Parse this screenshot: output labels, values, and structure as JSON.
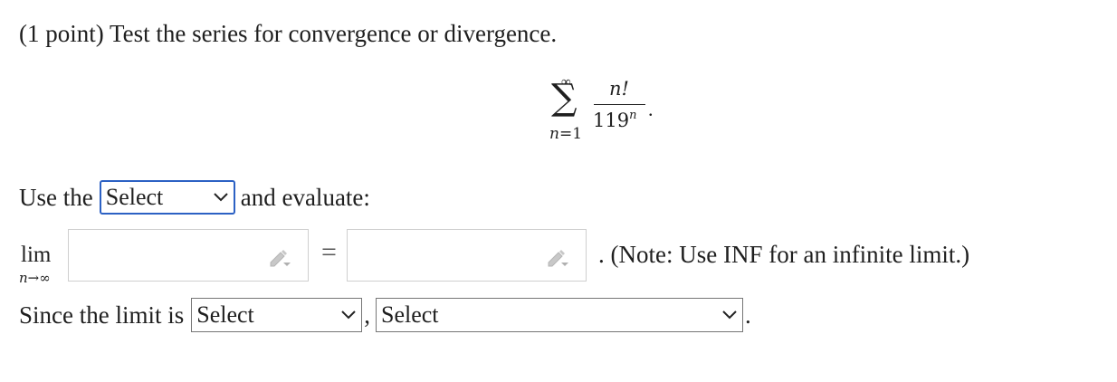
{
  "prompt": "(1 point) Test the series for convergence or divergence.",
  "series": {
    "upper": "∞",
    "sigma": "∑",
    "lower_var": "n",
    "lower_eq": "=1",
    "numerator": "n!",
    "denominator_base": "119",
    "denominator_exp": "n",
    "period": "."
  },
  "row1": {
    "use_the": "Use the",
    "test_select": "Select",
    "and_evaluate": "and evaluate:"
  },
  "limit": {
    "lim": "lim",
    "sub": "n→∞",
    "equals": "=",
    "note": ". (Note: Use INF for an infinite limit.)",
    "input1_value": "",
    "input2_value": ""
  },
  "row3": {
    "since": "Since the limit is",
    "limit_select": "Select",
    "comma": ",",
    "conclusion_select": "Select",
    "period": "."
  },
  "icons": {
    "dropdown": "chevron-down-icon",
    "pencil": "pencil-icon"
  },
  "colors": {
    "focus_border": "#2c61c4",
    "text": "#1f1f1f",
    "input_border": "#cfcfcf"
  }
}
